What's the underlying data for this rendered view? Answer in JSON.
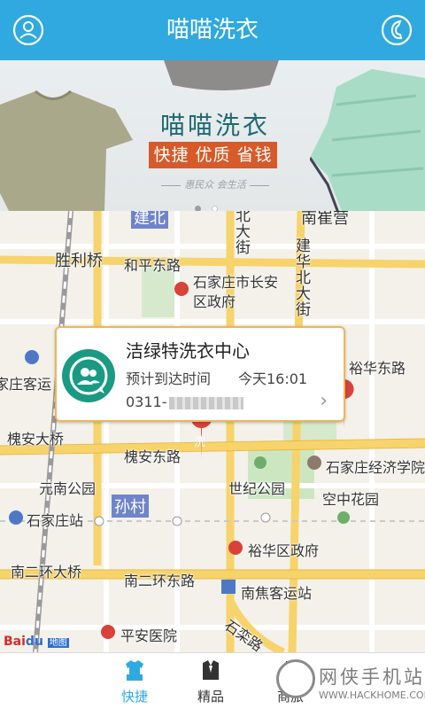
{
  "header": {
    "title": "喵喵洗衣",
    "left_icon": "user-icon",
    "right_icon": "phone-icon",
    "color": "#2fa9e0"
  },
  "banner": {
    "brand": "喵喵洗衣",
    "slogan": "快捷 优质 省钱",
    "tagline": "惠民众 会生活",
    "slide_count": 2,
    "active_slide": 1,
    "slogan_color": "#d75a2a"
  },
  "map": {
    "labels": {
      "jianbei": "建北",
      "nanwei": "南崔营",
      "shenghe": "胜利桥",
      "heping": "和平东路",
      "city_gov": "石家庄市长安区政府",
      "north_street": "北大街",
      "jianhua": "建华北大街",
      "station_left": "家庄客运",
      "yuhua_east": "裕华东路",
      "huaian_bridge": "槐安大桥",
      "huaian_east": "槐安东路",
      "economics": "石家庄经济学院",
      "park_west": "元南公园",
      "century_park": "世纪公园",
      "sky_garden": "空中花园",
      "sunvillage": "孙村",
      "sjz_station": "石家庄站",
      "yuhua_gov": "裕华区政府",
      "ring_bridge": "南二环大桥",
      "ring_east": "南二环东路",
      "nanjiao": "南焦客运站",
      "pingan": "平安医院",
      "shiluan": "石栾路",
      "pin_label": "洗"
    },
    "card": {
      "name": "洁绿特洗衣中心",
      "eta_label": "预计到达时间",
      "eta_value": "今天16:01",
      "phone_prefix": "0311-",
      "avatar_icon": "group-icon",
      "chevron_icon": "chevron-right-icon"
    },
    "logo": {
      "baidu": "Bai",
      "du": "du",
      "ditu": "地图"
    }
  },
  "tabbar": {
    "tabs": [
      {
        "label": "快捷",
        "icon": "shirt-icon",
        "active": true
      },
      {
        "label": "精品",
        "icon": "suit-icon",
        "active": false
      },
      {
        "label": "商旅",
        "icon": "bag-icon",
        "active": false
      }
    ]
  },
  "watermark": {
    "text": "网侠手机站",
    "url": "WWW.HACKHOME.COM"
  }
}
